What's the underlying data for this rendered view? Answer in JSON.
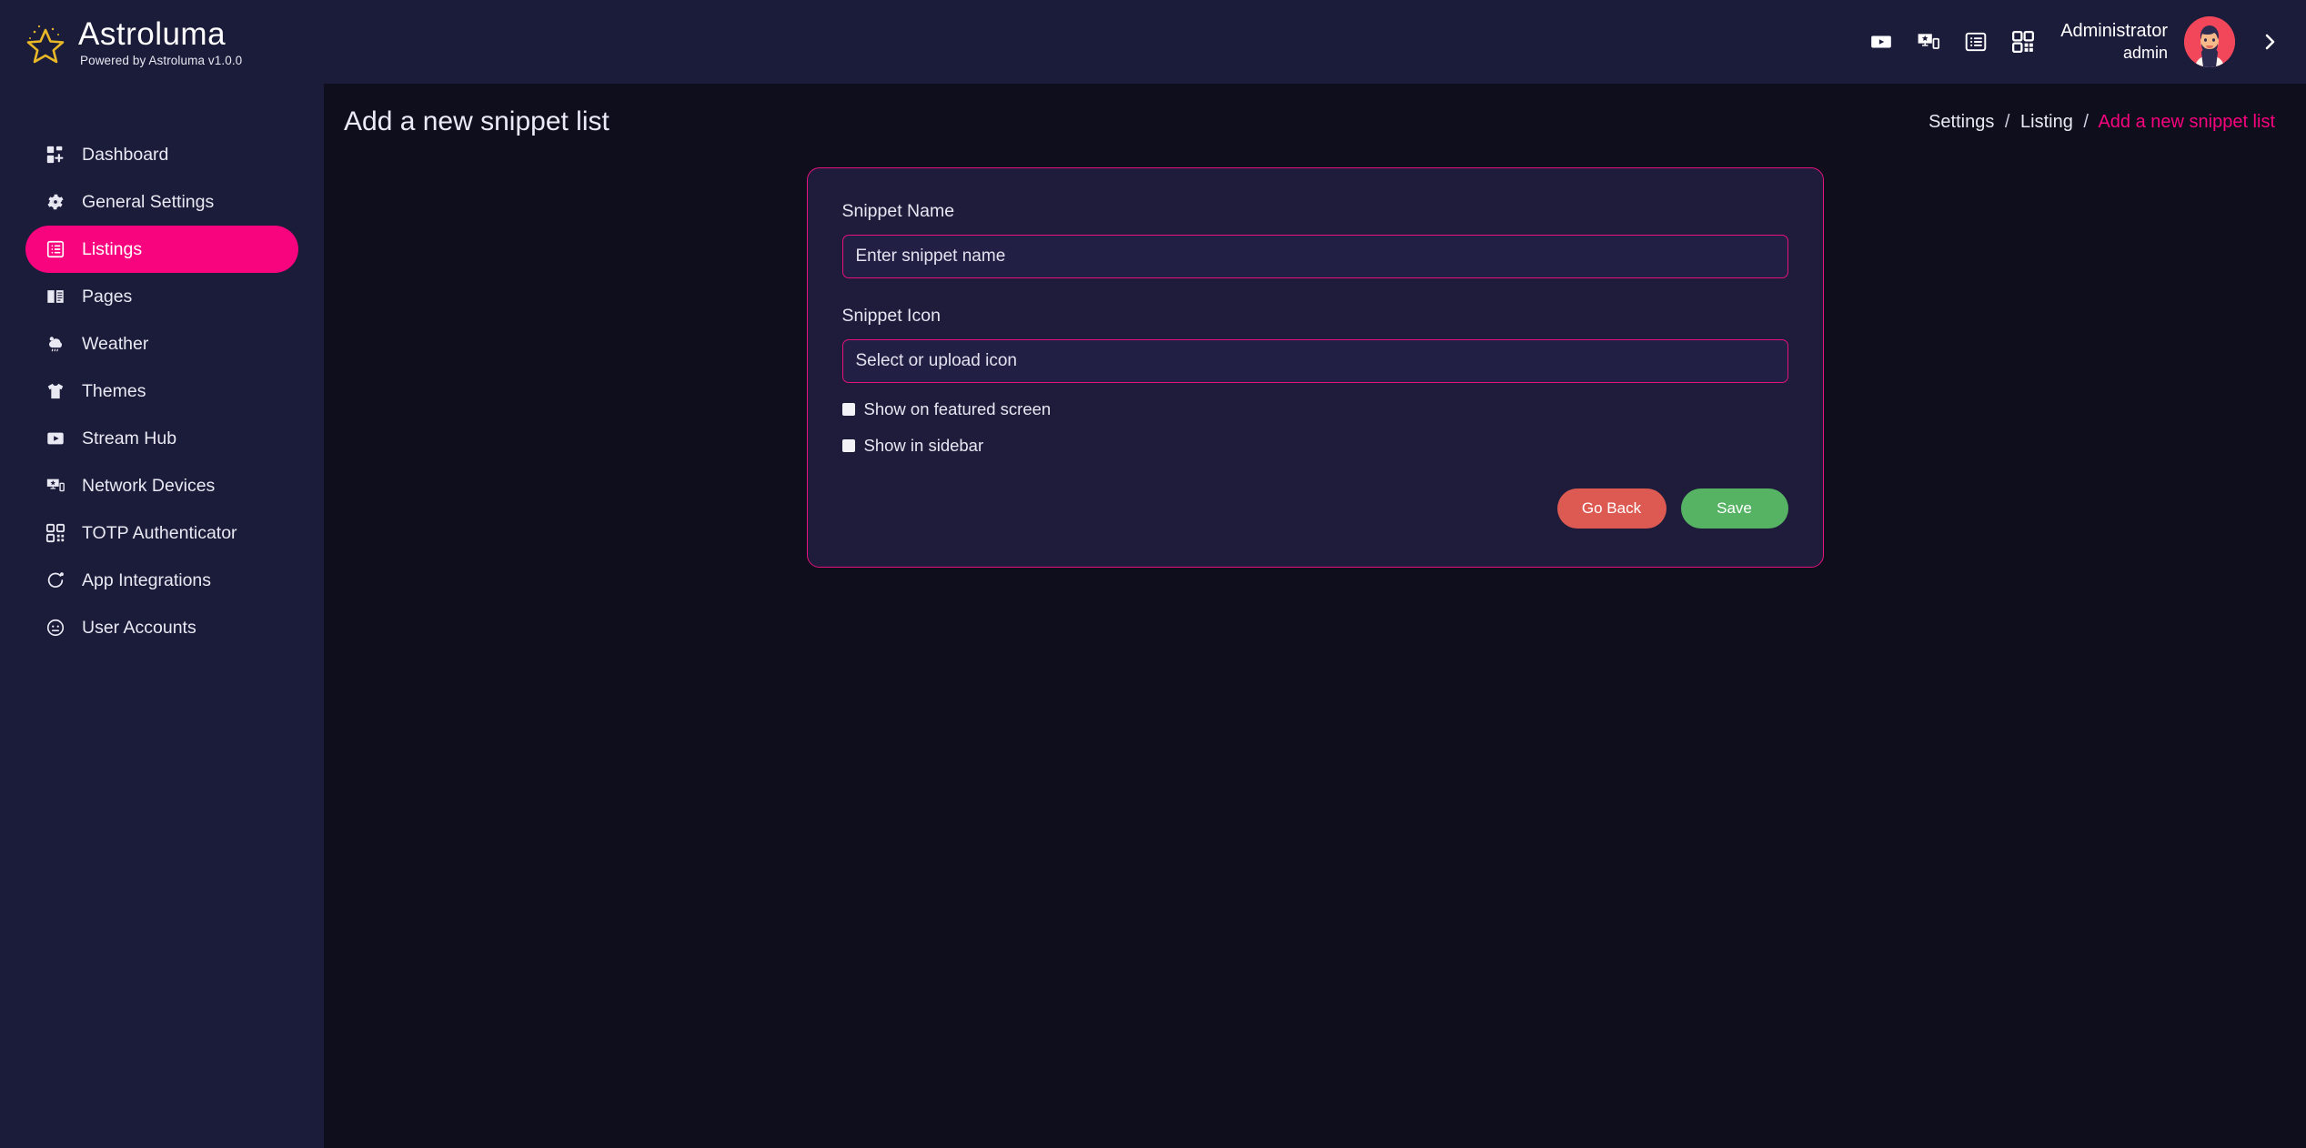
{
  "brand": {
    "logo_icon": "star-icon",
    "name": "Astroluma",
    "tagline": "Powered by Astroluma v1.0.0",
    "logo_color": "#e8b828"
  },
  "sidebar": {
    "items": [
      {
        "label": "Dashboard",
        "icon": "dashboard-grid-icon",
        "active": false
      },
      {
        "label": "General Settings",
        "icon": "gear-icon",
        "active": false
      },
      {
        "label": "Listings",
        "icon": "list-box-icon",
        "active": true
      },
      {
        "label": "Pages",
        "icon": "book-icon",
        "active": false
      },
      {
        "label": "Weather",
        "icon": "cloud-rain-icon",
        "active": false
      },
      {
        "label": "Themes",
        "icon": "tshirt-icon",
        "active": false
      },
      {
        "label": "Stream Hub",
        "icon": "play-box-icon",
        "active": false
      },
      {
        "label": "Network Devices",
        "icon": "devices-icon",
        "active": false
      },
      {
        "label": "TOTP Authenticator",
        "icon": "qr-code-icon",
        "active": false
      },
      {
        "label": "App Integrations",
        "icon": "refresh-dot-icon",
        "active": false
      },
      {
        "label": "User Accounts",
        "icon": "user-face-icon",
        "active": false
      }
    ],
    "active_color": "#f8047e",
    "background": "#1b1b3a"
  },
  "topbar": {
    "icons": [
      {
        "name": "play-video-icon"
      },
      {
        "name": "cast-screen-icon"
      },
      {
        "name": "list-view-icon"
      },
      {
        "name": "qr-code-icon"
      }
    ],
    "user": {
      "name": "Administrator",
      "role": "admin",
      "avatar": "user-avatar"
    },
    "expand_icon": "chevron-right-icon"
  },
  "page": {
    "title": "Add a new snippet list",
    "breadcrumb": {
      "items": [
        "Settings",
        "Listing"
      ],
      "separator": "/",
      "current": "Add a new snippet list"
    }
  },
  "form": {
    "accent_color": "#e5127e",
    "snippet_name": {
      "label": "Snippet Name",
      "placeholder": "Enter snippet name",
      "value": ""
    },
    "snippet_icon": {
      "label": "Snippet Icon",
      "placeholder": "Select or upload icon",
      "value": ""
    },
    "checkboxes": [
      {
        "label": "Show on featured screen",
        "checked": false
      },
      {
        "label": "Show in sidebar",
        "checked": false
      }
    ],
    "buttons": {
      "back": {
        "label": "Go Back",
        "color": "#dd5a52"
      },
      "save": {
        "label": "Save",
        "color": "#56b364"
      }
    }
  }
}
